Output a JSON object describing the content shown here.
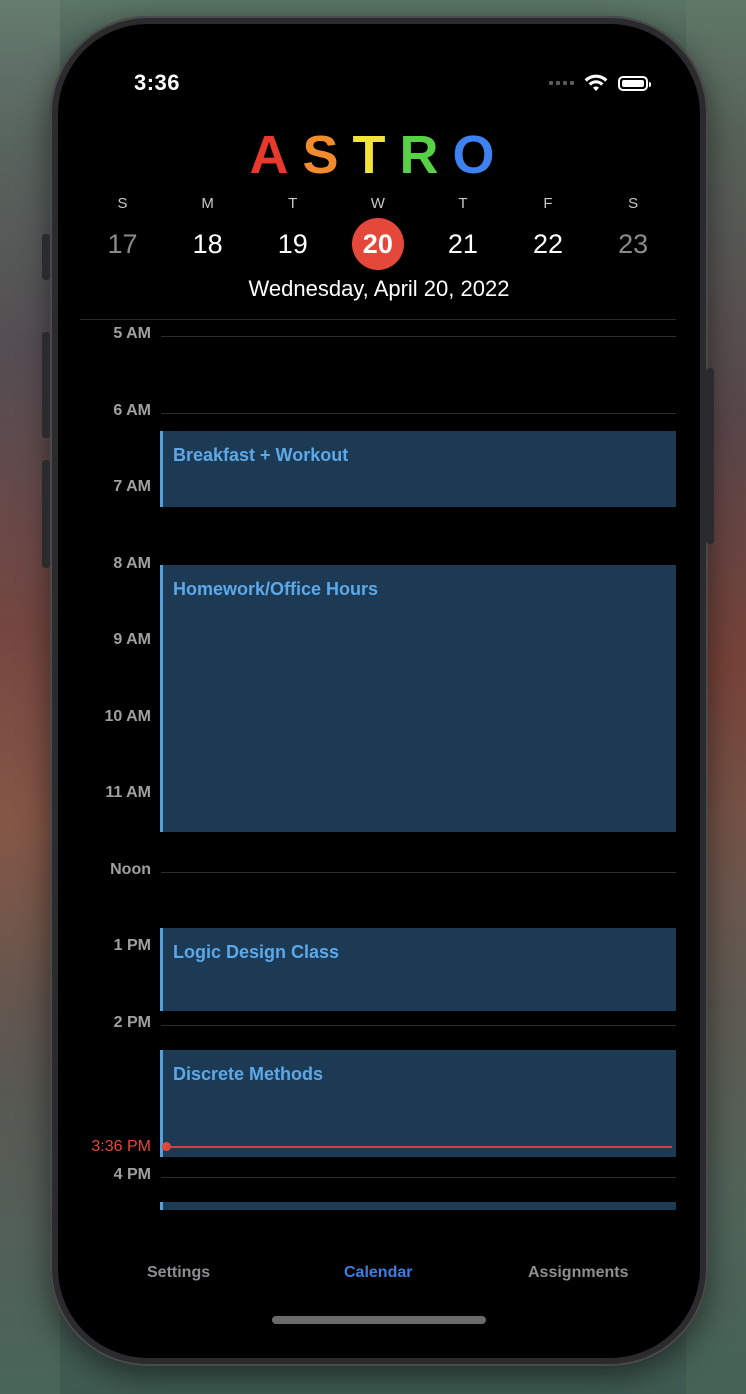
{
  "status_bar": {
    "time": "3:36"
  },
  "app": {
    "title_letters": [
      {
        "char": "A",
        "color": "#e8392c"
      },
      {
        "char": "S",
        "color": "#f28a2e"
      },
      {
        "char": "T",
        "color": "#f3e33a"
      },
      {
        "char": "R",
        "color": "#58d147"
      },
      {
        "char": "O",
        "color": "#3d82f0"
      }
    ]
  },
  "week": {
    "days": [
      {
        "letter": "S",
        "number": "17"
      },
      {
        "letter": "M",
        "number": "18"
      },
      {
        "letter": "T",
        "number": "19"
      },
      {
        "letter": "W",
        "number": "20"
      },
      {
        "letter": "T",
        "number": "21"
      },
      {
        "letter": "F",
        "number": "22"
      },
      {
        "letter": "S",
        "number": "23"
      }
    ],
    "selected_index": 3,
    "selected_color": "#e5483b"
  },
  "selected_date": "Wednesday, April 20, 2022",
  "timeline": {
    "hours": [
      "5 AM",
      "6 AM",
      "7 AM",
      "8 AM",
      "9 AM",
      "10 AM",
      "11 AM",
      "Noon",
      "1 PM",
      "2 PM",
      "4 PM"
    ],
    "events": [
      {
        "title": "Breakfast + Workout"
      },
      {
        "title": "Homework/Office Hours"
      },
      {
        "title": "Logic Design Class"
      },
      {
        "title": "Discrete Methods"
      },
      {
        "title": ""
      }
    ],
    "now_label": "3:36 PM",
    "now_color": "#e5483b",
    "event_color": "#1d3a55",
    "event_text_color": "#5ca8e8"
  },
  "tab_bar": {
    "tabs": [
      {
        "label": "Settings",
        "active": false
      },
      {
        "label": "Calendar",
        "active": true
      },
      {
        "label": "Assignments",
        "active": false
      }
    ],
    "active_color": "#3d7fe0"
  }
}
